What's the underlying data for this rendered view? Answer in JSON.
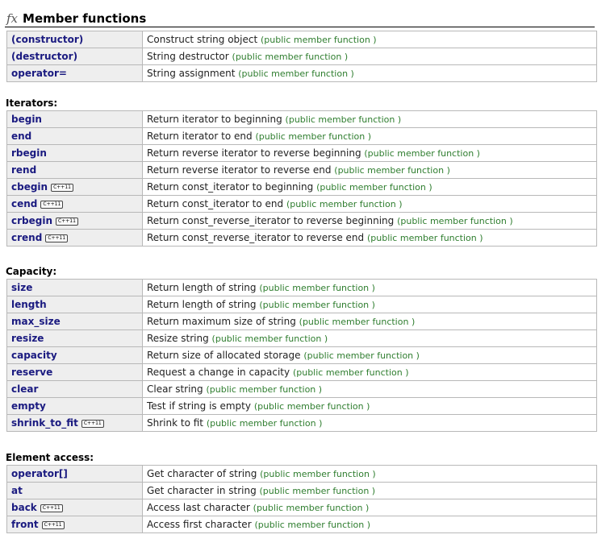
{
  "section": {
    "icon_text": "fx",
    "title": "Member functions"
  },
  "kind_label": "(public member function )",
  "badge_label": "C++11",
  "top": [
    {
      "name": "(constructor)",
      "desc": "Construct string object",
      "kind": "(public member function )",
      "badge": ""
    },
    {
      "name": "(destructor)",
      "desc": "String destructor",
      "kind": "(public member function )",
      "badge": ""
    },
    {
      "name": "operator=",
      "desc": "String assignment",
      "kind": "(public member function )",
      "badge": ""
    }
  ],
  "iterators": {
    "title": "Iterators:",
    "rows": [
      {
        "name": "begin",
        "desc": "Return iterator to beginning",
        "kind": "(public member function )",
        "badge": ""
      },
      {
        "name": "end",
        "desc": "Return iterator to end",
        "kind": "(public member function )",
        "badge": ""
      },
      {
        "name": "rbegin",
        "desc": "Return reverse iterator to reverse beginning",
        "kind": "(public member function )",
        "badge": ""
      },
      {
        "name": "rend",
        "desc": "Return reverse iterator to reverse end",
        "kind": "(public member function )",
        "badge": ""
      },
      {
        "name": "cbegin",
        "desc": "Return const_iterator to beginning",
        "kind": "(public member function )",
        "badge": "C++11"
      },
      {
        "name": "cend",
        "desc": "Return const_iterator to end",
        "kind": "(public member function )",
        "badge": "C++11"
      },
      {
        "name": "crbegin",
        "desc": "Return const_reverse_iterator to reverse beginning",
        "kind": "(public member function )",
        "badge": "C++11"
      },
      {
        "name": "crend",
        "desc": "Return const_reverse_iterator to reverse end",
        "kind": "(public member function )",
        "badge": "C++11"
      }
    ]
  },
  "capacity": {
    "title": "Capacity:",
    "rows": [
      {
        "name": "size",
        "desc": "Return length of string",
        "kind": "(public member function )",
        "badge": ""
      },
      {
        "name": "length",
        "desc": "Return length of string",
        "kind": "(public member function )",
        "badge": ""
      },
      {
        "name": "max_size",
        "desc": "Return maximum size of string",
        "kind": "(public member function )",
        "badge": ""
      },
      {
        "name": "resize",
        "desc": "Resize string",
        "kind": "(public member function )",
        "badge": ""
      },
      {
        "name": "capacity",
        "desc": "Return size of allocated storage",
        "kind": "(public member function )",
        "badge": ""
      },
      {
        "name": "reserve",
        "desc": "Request a change in capacity",
        "kind": "(public member function )",
        "badge": ""
      },
      {
        "name": "clear",
        "desc": "Clear string",
        "kind": "(public member function )",
        "badge": ""
      },
      {
        "name": "empty",
        "desc": "Test if string is empty",
        "kind": "(public member function )",
        "badge": ""
      },
      {
        "name": "shrink_to_fit",
        "desc": "Shrink to fit",
        "kind": "(public member function )",
        "badge": "C++11"
      }
    ]
  },
  "element_access": {
    "title": "Element access:",
    "rows": [
      {
        "name": "operator[]",
        "desc": "Get character of string",
        "kind": "(public member function )",
        "badge": ""
      },
      {
        "name": "at",
        "desc": "Get character in string",
        "kind": "(public member function )",
        "badge": ""
      },
      {
        "name": "back",
        "desc": "Access last character",
        "kind": "(public member function )",
        "badge": "C++11"
      },
      {
        "name": "front",
        "desc": "Access first character",
        "kind": "(public member function )",
        "badge": "C++11"
      }
    ]
  }
}
